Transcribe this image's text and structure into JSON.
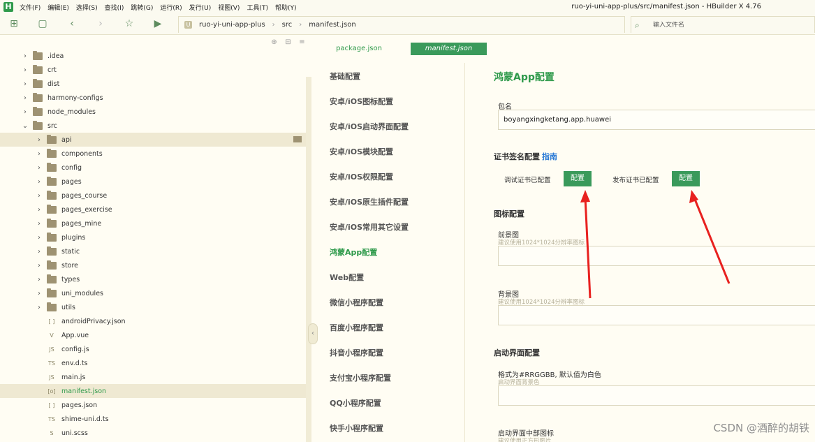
{
  "menubar": {
    "logo": "H",
    "menus": [
      "文件(F)",
      "编辑(E)",
      "选择(S)",
      "查找(I)",
      "跳转(G)",
      "运行(R)",
      "发行(U)",
      "视图(V)",
      "工具(T)",
      "帮助(Y)"
    ],
    "window_title": "ruo-yi-uni-app-plus/src/manifest.json - HBuilder X 4.76"
  },
  "breadcrumb": {
    "u_badge": "U",
    "items": [
      "ruo-yi-uni-app-plus",
      "src",
      "manifest.json"
    ]
  },
  "search": {
    "placeholder": "输入文件名"
  },
  "tree": {
    "items": [
      {
        "label": ".idea",
        "type": "folder"
      },
      {
        "label": "crt",
        "type": "folder"
      },
      {
        "label": "dist",
        "type": "folder"
      },
      {
        "label": "harmony-configs",
        "type": "folder"
      },
      {
        "label": "node_modules",
        "type": "folder"
      },
      {
        "label": "src",
        "type": "folder-open"
      },
      {
        "label": "api",
        "type": "folder"
      },
      {
        "label": "components",
        "type": "folder"
      },
      {
        "label": "config",
        "type": "folder"
      },
      {
        "label": "pages",
        "type": "folder"
      },
      {
        "label": "pages_course",
        "type": "folder"
      },
      {
        "label": "pages_exercise",
        "type": "folder"
      },
      {
        "label": "pages_mine",
        "type": "folder"
      },
      {
        "label": "plugins",
        "type": "folder"
      },
      {
        "label": "static",
        "type": "folder"
      },
      {
        "label": "store",
        "type": "folder"
      },
      {
        "label": "types",
        "type": "folder"
      },
      {
        "label": "uni_modules",
        "type": "folder"
      },
      {
        "label": "utils",
        "type": "folder"
      },
      {
        "label": "androidPrivacy.json",
        "type": "file",
        "glyph": "[ ]"
      },
      {
        "label": "App.vue",
        "type": "file",
        "glyph": "V"
      },
      {
        "label": "config.js",
        "type": "file",
        "glyph": "JS"
      },
      {
        "label": "env.d.ts",
        "type": "file",
        "glyph": "TS"
      },
      {
        "label": "main.js",
        "type": "file",
        "glyph": "JS"
      },
      {
        "label": "manifest.json",
        "type": "file",
        "glyph": "[o]"
      },
      {
        "label": "pages.json",
        "type": "file",
        "glyph": "[ ]"
      },
      {
        "label": "shime-uni.d.ts",
        "type": "file",
        "glyph": "TS"
      },
      {
        "label": "uni.scss",
        "type": "file",
        "glyph": "S"
      }
    ]
  },
  "tabs": {
    "package": "package.json",
    "manifest": "manifest.json"
  },
  "nav": {
    "items": [
      "基础配置",
      "安卓/iOS图标配置",
      "安卓/iOS启动界面配置",
      "安卓/iOS模块配置",
      "安卓/iOS权限配置",
      "安卓/iOS原生插件配置",
      "安卓/iOS常用其它设置",
      "鸿蒙App配置",
      "Web配置",
      "微信小程序配置",
      "百度小程序配置",
      "抖音小程序配置",
      "支付宝小程序配置",
      "QQ小程序配置",
      "快手小程序配置"
    ]
  },
  "content": {
    "title": "鸿蒙App配置",
    "package_label": "包名",
    "package_value": "boyangxingketang.app.huawei",
    "cert_section": "证书签名配置",
    "cert_guide": "指南",
    "debug_cert": "调试证书已配置",
    "release_cert": "发布证书已配置",
    "config_btn": "配置",
    "icon_section": "图标配置",
    "fg_label": "前景图",
    "fg_hint": "建议使用1024*1024分辨率图标",
    "bg_label": "背景图",
    "bg_hint": "建议使用1024*1024分辨率图标",
    "splash_section": "启动界面配置",
    "color_label": "格式为#RRGGBB, 默认值为白色",
    "color_hint": "启动界面背景色",
    "center_icon_label": "启动界面中部图标",
    "center_icon_hint": "建议使用正方形图片"
  },
  "watermark": "CSDN @酒醉的胡铁",
  "colors": {
    "accent": "#2f9a4b",
    "button": "#3a9a5b",
    "annotation_arrow": "#e8211f",
    "link": "#2b7bd6"
  }
}
